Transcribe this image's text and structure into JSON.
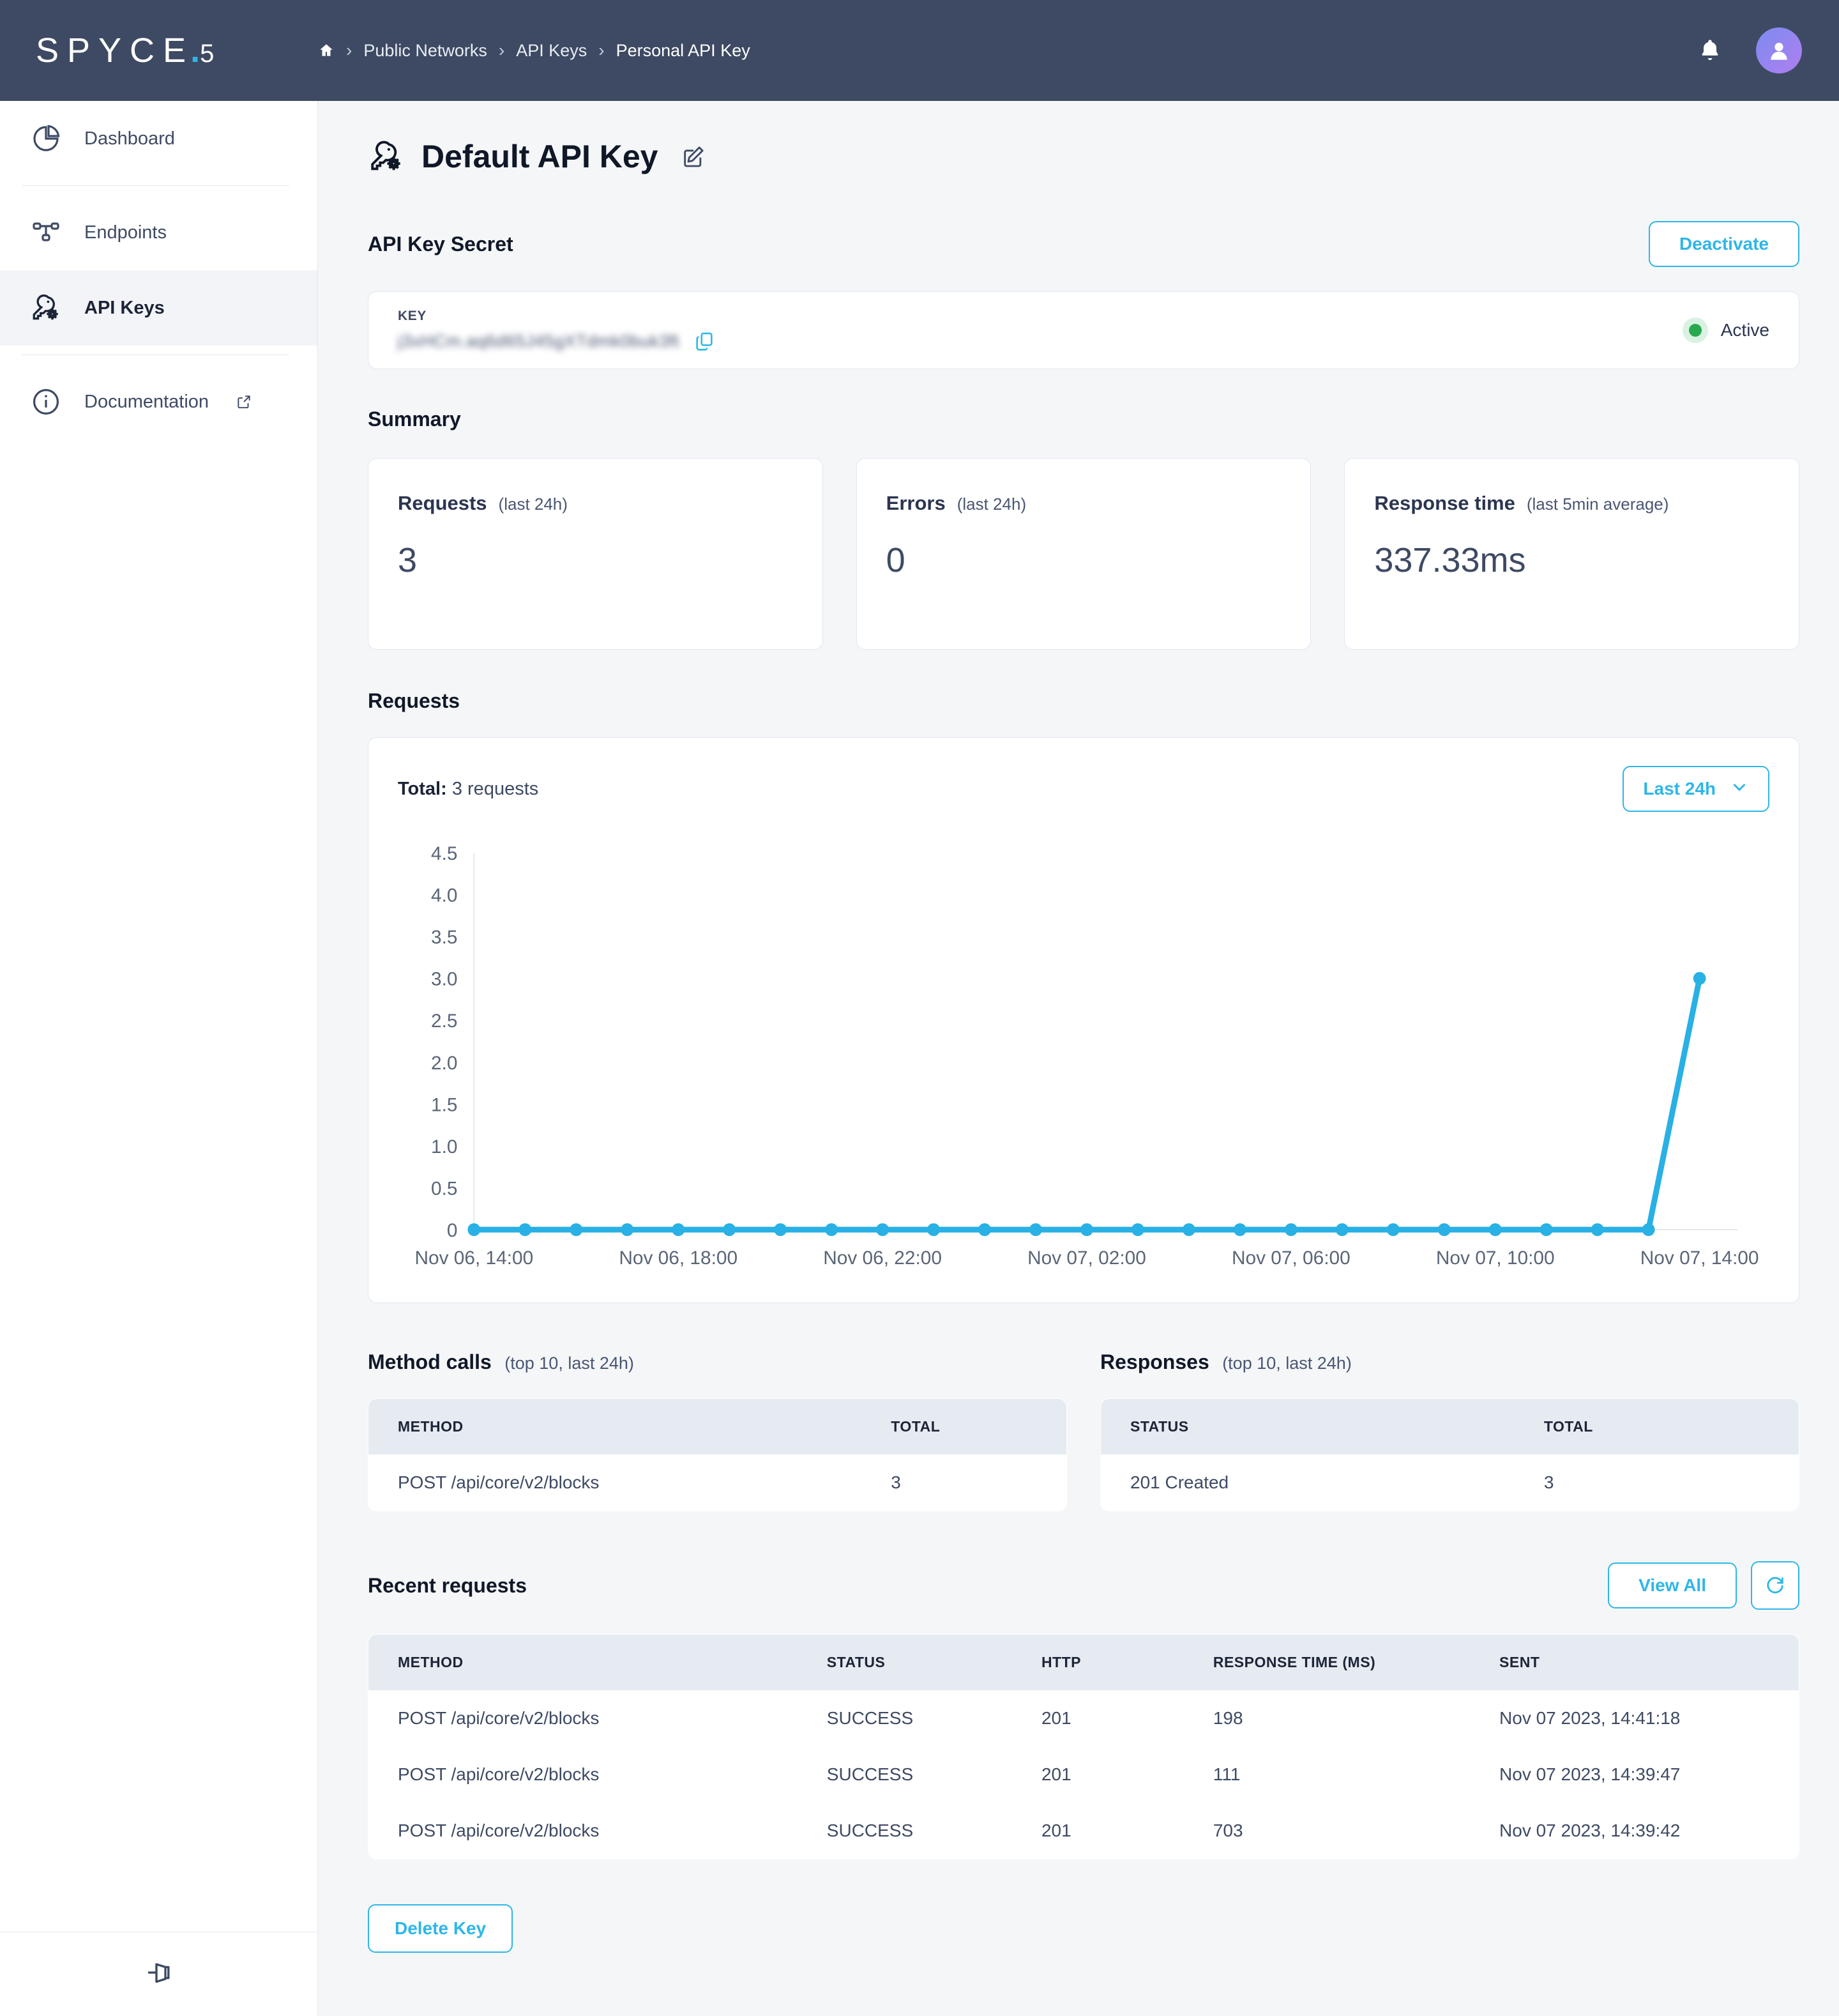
{
  "brand": {
    "name": "SPYCE",
    "dot": ".",
    "suffix": "5"
  },
  "breadcrumb": {
    "home_icon": "home-icon",
    "items": [
      "Public Networks",
      "API Keys",
      "Personal API Key"
    ],
    "separator": "›"
  },
  "header": {
    "notifications_icon": "bell-icon",
    "avatar_icon": "user-avatar-icon"
  },
  "sidebar": {
    "items": [
      {
        "label": "Dashboard",
        "icon": "pie-chart-icon",
        "active": false,
        "external": false
      },
      {
        "label": "Endpoints",
        "icon": "network-nodes-icon",
        "active": false,
        "external": false
      },
      {
        "label": "API Keys",
        "icon": "key-gear-icon",
        "active": true,
        "external": false
      },
      {
        "label": "Documentation",
        "icon": "info-circle-icon",
        "active": false,
        "external": true
      }
    ],
    "collapse_icon": "collapse-panel-icon"
  },
  "page": {
    "title": "Default API Key",
    "title_icon": "key-gear-icon",
    "edit_icon": "edit-pencil-icon"
  },
  "secret": {
    "section_title": "API Key Secret",
    "deactivate_label": "Deactivate",
    "key_label": "KEY",
    "key_value": "j3xHCm.aq6d65J45gXTdmk0buk3ft",
    "copy_icon": "copy-icon",
    "status_label": "Active",
    "status_color": "#2aa84f"
  },
  "summary": {
    "section_title": "Summary",
    "cards": [
      {
        "label": "Requests",
        "note": "(last 24h)",
        "value": "3"
      },
      {
        "label": "Errors",
        "note": "(last 24h)",
        "value": "0"
      },
      {
        "label": "Response time",
        "note": "(last 5min average)",
        "value": "337.33ms"
      }
    ]
  },
  "requests": {
    "section_title": "Requests",
    "total_prefix": "Total:",
    "total_text": "3 requests",
    "range_label": "Last 24h",
    "chevron_icon": "chevron-down-icon"
  },
  "chart_data": {
    "type": "line",
    "title": "Requests",
    "xlabel": "",
    "ylabel": "",
    "ylim": [
      0,
      4.5
    ],
    "yticks": [
      "0",
      "0.5",
      "1.0",
      "1.5",
      "2.0",
      "2.5",
      "3.0",
      "3.5",
      "4.0",
      "4.5"
    ],
    "xtick_labels": [
      "Nov 06, 14:00",
      "Nov 06, 18:00",
      "Nov 06, 22:00",
      "Nov 07, 02:00",
      "Nov 07, 06:00",
      "Nov 07, 10:00",
      "Nov 07, 14:00"
    ],
    "x": [
      "Nov 06, 14:00",
      "Nov 06, 15:00",
      "Nov 06, 16:00",
      "Nov 06, 17:00",
      "Nov 06, 18:00",
      "Nov 06, 19:00",
      "Nov 06, 20:00",
      "Nov 06, 21:00",
      "Nov 06, 22:00",
      "Nov 06, 23:00",
      "Nov 07, 00:00",
      "Nov 07, 01:00",
      "Nov 07, 02:00",
      "Nov 07, 03:00",
      "Nov 07, 04:00",
      "Nov 07, 05:00",
      "Nov 07, 06:00",
      "Nov 07, 07:00",
      "Nov 07, 08:00",
      "Nov 07, 09:00",
      "Nov 07, 10:00",
      "Nov 07, 11:00",
      "Nov 07, 12:00",
      "Nov 07, 13:00",
      "Nov 07, 14:00"
    ],
    "series": [
      {
        "name": "Requests",
        "color": "#29b0e4",
        "values": [
          0,
          0,
          0,
          0,
          0,
          0,
          0,
          0,
          0,
          0,
          0,
          0,
          0,
          0,
          0,
          0,
          0,
          0,
          0,
          0,
          0,
          0,
          0,
          0,
          3
        ]
      }
    ],
    "grid": false,
    "legend": "none"
  },
  "method_calls": {
    "section_title": "Method calls",
    "section_note": "(top 10, last 24h)",
    "columns": [
      "METHOD",
      "TOTAL"
    ],
    "rows": [
      [
        "POST /api/core/v2/blocks",
        "3"
      ]
    ]
  },
  "responses": {
    "section_title": "Responses",
    "section_note": "(top 10, last 24h)",
    "columns": [
      "STATUS",
      "TOTAL"
    ],
    "rows": [
      [
        "201 Created",
        "3"
      ]
    ]
  },
  "recent_requests": {
    "section_title": "Recent requests",
    "view_all_label": "View All",
    "refresh_icon": "refresh-icon",
    "columns": [
      "METHOD",
      "STATUS",
      "HTTP",
      "RESPONSE TIME (MS)",
      "SENT"
    ],
    "rows": [
      [
        "POST /api/core/v2/blocks",
        "SUCCESS",
        "201",
        "198",
        "Nov 07 2023, 14:41:18"
      ],
      [
        "POST /api/core/v2/blocks",
        "SUCCESS",
        "201",
        "111",
        "Nov 07 2023, 14:39:47"
      ],
      [
        "POST /api/core/v2/blocks",
        "SUCCESS",
        "201",
        "703",
        "Nov 07 2023, 14:39:42"
      ]
    ]
  },
  "footer": {
    "delete_label": "Delete Key"
  },
  "colors": {
    "accent": "#2eb6e8",
    "navy": "#3e4a63",
    "chart_line": "#29b0e4",
    "active_green": "#2aa84f"
  }
}
